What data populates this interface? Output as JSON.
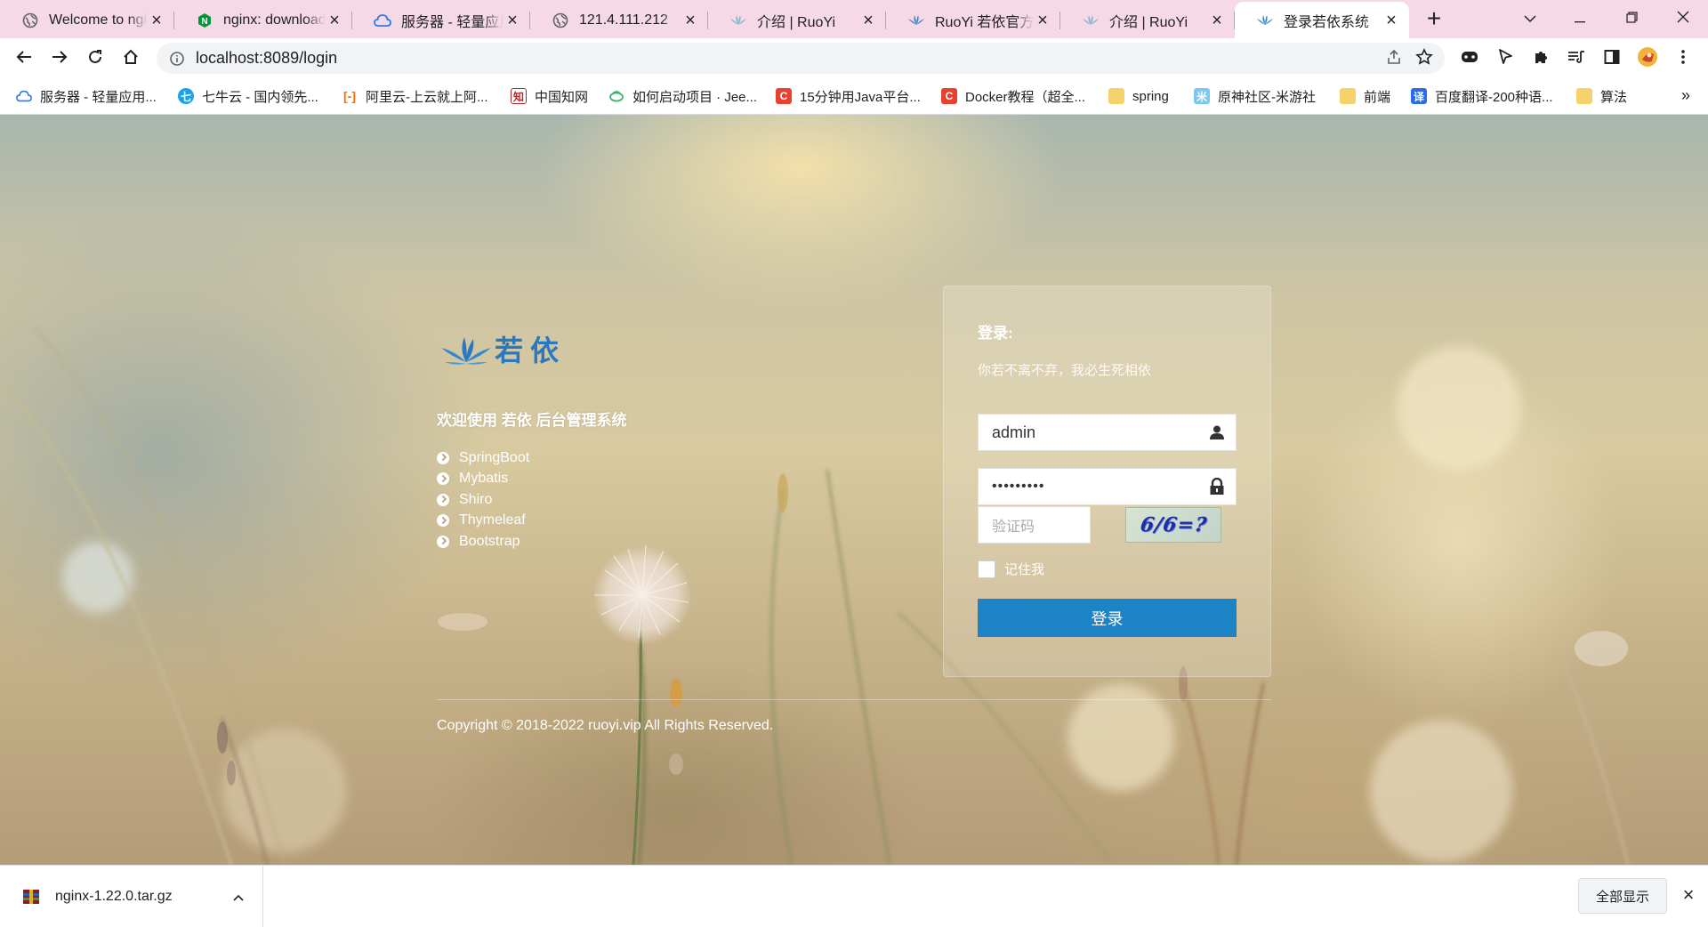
{
  "browser": {
    "tabs": [
      {
        "title": "Welcome to nginx!",
        "icon": "globe-icon"
      },
      {
        "title": "nginx: download",
        "icon": "nginx-icon"
      },
      {
        "title": "服务器 - 轻量应用服务器",
        "icon": "cloud-icon"
      },
      {
        "title": "121.4.111.212",
        "icon": "globe-icon"
      },
      {
        "title": "介绍 | RuoYi",
        "icon": "ruoyi-icon"
      },
      {
        "title": "RuoYi 若依官方网站",
        "icon": "ruoyi-icon"
      },
      {
        "title": "介绍 | RuoYi",
        "icon": "ruoyi-icon"
      },
      {
        "title": "登录若依系统",
        "icon": "ruoyi-icon",
        "active": true
      }
    ],
    "url": "localhost:8089/login",
    "bookmarks": [
      {
        "label": "服务器 - 轻量应用...",
        "color": "#2b7de9"
      },
      {
        "label": "七牛云 - 国内领先...",
        "color": "#1aa3e8"
      },
      {
        "label": "阿里云-上云就上阿...",
        "color": "#ff6a00"
      },
      {
        "label": "中国知网",
        "color": "#b3282d"
      },
      {
        "label": "如何启动项目 · Jee...",
        "color": "#3cb371"
      },
      {
        "label": "15分钟用Java平台...",
        "color": "#e8412f"
      },
      {
        "label": "Docker教程（超全...",
        "color": "#e8412f"
      },
      {
        "label": "spring",
        "color": "#f6d36a"
      },
      {
        "label": "原神社区-米游社",
        "color": "#7ec8f0"
      },
      {
        "label": "前端",
        "color": "#f6d36a"
      },
      {
        "label": "百度翻译-200种语...",
        "color": "#2b6de9"
      },
      {
        "label": "算法",
        "color": "#f6d36a"
      }
    ],
    "accent": "#1c84c6"
  },
  "page": {
    "logo_text": "若依",
    "welcome": "欢迎使用 若依 后台管理系统",
    "features": [
      "SpringBoot",
      "Mybatis",
      "Shiro",
      "Thymeleaf",
      "Bootstrap"
    ],
    "login": {
      "title": "登录:",
      "subtitle": "你若不离不弃，我必生死相依",
      "username": "admin",
      "password": "•••••••••",
      "captcha_placeholder": "验证码",
      "captcha_text": "6/6=?",
      "remember_label": "记住我",
      "submit_label": "登录"
    },
    "copyright": "Copyright © 2018-2022 ruoyi.vip All Rights Reserved."
  },
  "downloads": {
    "file": "nginx-1.22.0.tar.gz",
    "show_all": "全部显示"
  }
}
